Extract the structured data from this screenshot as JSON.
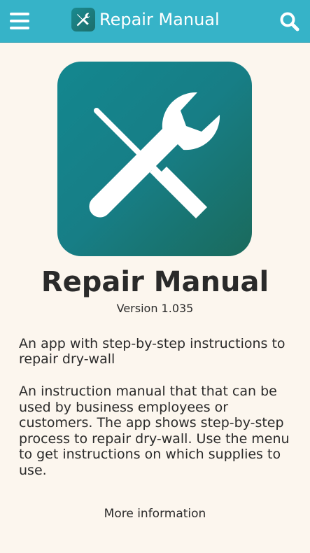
{
  "header": {
    "title": "Repair Manual",
    "menu_icon": "hamburger-menu-icon",
    "search_icon": "search-icon",
    "app_icon": "wrench-screwdriver-icon",
    "bar_color": "#36b3c8"
  },
  "app": {
    "name": "Repair Manual",
    "version": "Version 1.035",
    "tagline": "An app with step-by-step instructions to repair dry-wall",
    "description": "An instruction manual that that can be used by business employees or customers. The app shows step-by-step process to repair dry-wall. Use the menu to get instructions on which supplies to use.",
    "more_info_label": "More information",
    "icon_gradient": [
      "#13878f",
      "#1a6a5c"
    ]
  }
}
